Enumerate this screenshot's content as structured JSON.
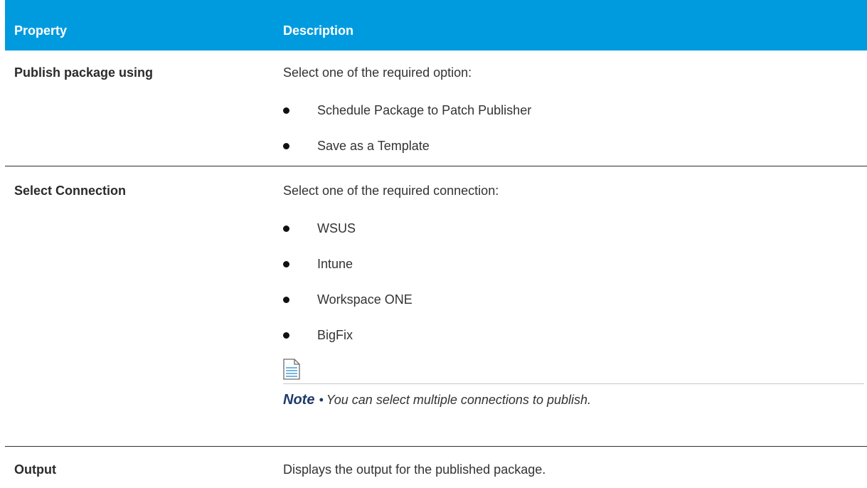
{
  "header": {
    "property": "Property",
    "description": "Description"
  },
  "rows": [
    {
      "property": "Publish package using",
      "description": "Select one of the required option:",
      "bullets": [
        "Schedule Package to Patch Publisher",
        "Save as a Template"
      ]
    },
    {
      "property": "Select Connection",
      "description": "Select one of the required connection:",
      "bullets": [
        "WSUS",
        "Intune",
        "Workspace ONE",
        "BigFix"
      ],
      "note": {
        "label": "Note",
        "separator": "•",
        "text": "You can select multiple connections to publish."
      }
    },
    {
      "property": "Output",
      "description": "Displays the output for the published package."
    }
  ],
  "colors": {
    "header_bg": "#009bdf",
    "header_text": "#ffffff",
    "note_label": "#1f3a6b"
  },
  "icons": {
    "note": "document-note-icon"
  }
}
